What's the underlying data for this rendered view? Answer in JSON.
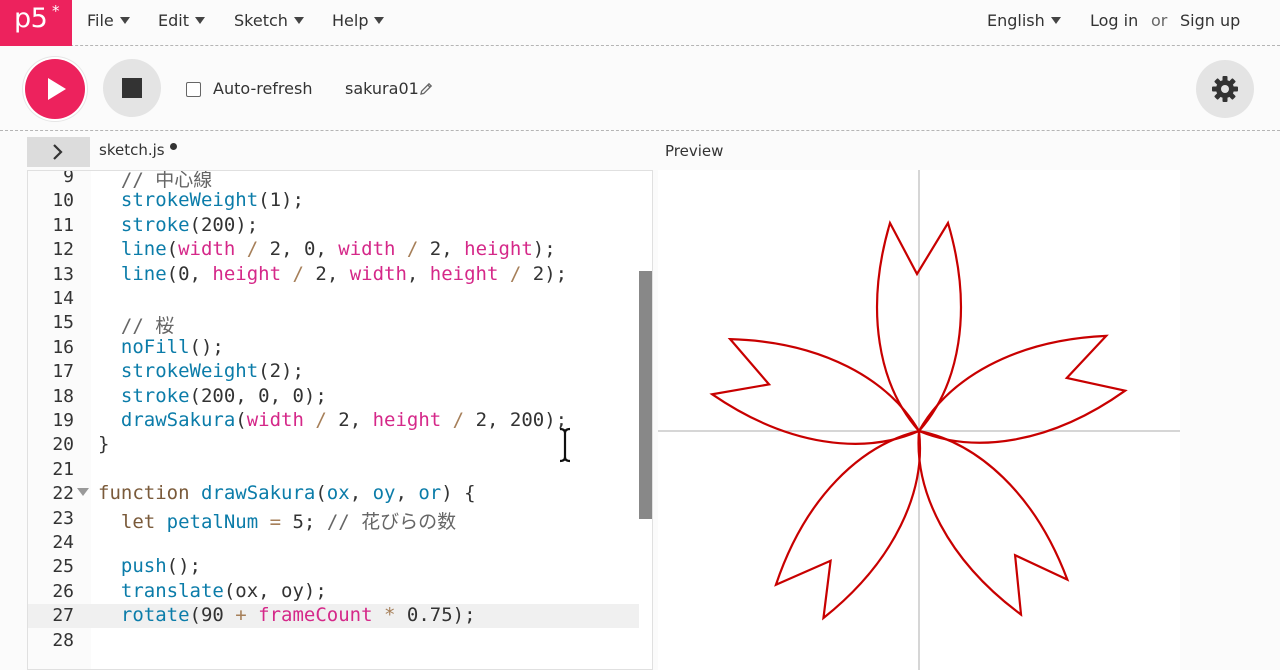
{
  "nav": {
    "logo": "p5",
    "logo_star": "*",
    "menus": [
      "File",
      "Edit",
      "Sketch",
      "Help"
    ],
    "language": "English",
    "login": "Log in",
    "or": "or",
    "signup": "Sign up"
  },
  "toolbar": {
    "auto_refresh_label": "Auto-refresh",
    "auto_refresh_checked": false,
    "sketch_name": "sakura01"
  },
  "editor": {
    "file_tab": "sketch.js",
    "unsaved": true,
    "lines": [
      {
        "num": "9",
        "tokens": [
          [
            "cm",
            "  // 中心線"
          ]
        ]
      },
      {
        "num": "10",
        "tokens": [
          [
            "fn",
            "  strokeWeight"
          ],
          [
            "",
            "(1);"
          ]
        ]
      },
      {
        "num": "11",
        "tokens": [
          [
            "fn",
            "  stroke"
          ],
          [
            "",
            "(200);"
          ]
        ]
      },
      {
        "num": "12",
        "tokens": [
          [
            "fn",
            "  line"
          ],
          [
            "",
            "("
          ],
          [
            "var",
            "width"
          ],
          [
            "op",
            " / "
          ],
          [
            "",
            "2, 0, "
          ],
          [
            "var",
            "width"
          ],
          [
            "op",
            " / "
          ],
          [
            "",
            "2, "
          ],
          [
            "var",
            "height"
          ],
          [
            "",
            ");"
          ]
        ]
      },
      {
        "num": "13",
        "tokens": [
          [
            "fn",
            "  line"
          ],
          [
            "",
            "(0, "
          ],
          [
            "var",
            "height"
          ],
          [
            "op",
            " / "
          ],
          [
            "",
            "2, "
          ],
          [
            "var",
            "width"
          ],
          [
            "",
            ", "
          ],
          [
            "var",
            "height"
          ],
          [
            "op",
            " / "
          ],
          [
            "",
            "2);"
          ]
        ]
      },
      {
        "num": "14",
        "tokens": []
      },
      {
        "num": "15",
        "tokens": [
          [
            "cm",
            "  // 桜"
          ]
        ]
      },
      {
        "num": "16",
        "tokens": [
          [
            "fn",
            "  noFill"
          ],
          [
            "",
            "();"
          ]
        ]
      },
      {
        "num": "17",
        "tokens": [
          [
            "fn",
            "  strokeWeight"
          ],
          [
            "",
            "(2);"
          ]
        ]
      },
      {
        "num": "18",
        "tokens": [
          [
            "fn",
            "  stroke"
          ],
          [
            "",
            "(200, 0, 0);"
          ]
        ]
      },
      {
        "num": "19",
        "tokens": [
          [
            "fn",
            "  drawSakura"
          ],
          [
            "",
            "("
          ],
          [
            "var",
            "width"
          ],
          [
            "op",
            " / "
          ],
          [
            "",
            "2, "
          ],
          [
            "var",
            "height"
          ],
          [
            "op",
            " / "
          ],
          [
            "",
            "2, 200);"
          ]
        ]
      },
      {
        "num": "20",
        "tokens": [
          [
            "",
            "}"
          ]
        ]
      },
      {
        "num": "21",
        "tokens": []
      },
      {
        "num": "22",
        "fold": true,
        "tokens": [
          [
            "kw",
            "function "
          ],
          [
            "fn",
            "drawSakura"
          ],
          [
            "",
            "("
          ],
          [
            "fn",
            "ox"
          ],
          [
            "",
            ", "
          ],
          [
            "fn",
            "oy"
          ],
          [
            "",
            ", "
          ],
          [
            "fn",
            "or"
          ],
          [
            "",
            ") {"
          ]
        ]
      },
      {
        "num": "23",
        "tokens": [
          [
            "kw",
            "  let "
          ],
          [
            "fn",
            "petalNum"
          ],
          [
            "op",
            " = "
          ],
          [
            "",
            "5; "
          ],
          [
            "cm",
            "// 花びらの数"
          ]
        ]
      },
      {
        "num": "24",
        "tokens": []
      },
      {
        "num": "25",
        "tokens": [
          [
            "fn",
            "  push"
          ],
          [
            "",
            "();"
          ]
        ]
      },
      {
        "num": "26",
        "tokens": [
          [
            "fn",
            "  translate"
          ],
          [
            "",
            "(ox, oy);"
          ]
        ]
      },
      {
        "num": "27",
        "active": true,
        "tokens": [
          [
            "fn",
            "  rotate"
          ],
          [
            "",
            "(90 "
          ],
          [
            "op",
            "+ "
          ],
          [
            "var",
            "frameCount"
          ],
          [
            "op",
            " * "
          ],
          [
            "",
            "0.75);"
          ]
        ]
      },
      {
        "num": "28",
        "tokens": []
      }
    ]
  },
  "preview": {
    "label": "Preview",
    "crosshair_color": "#c8c8c8",
    "sakura_color": "#c80000",
    "petal_count": 5
  },
  "icons": {
    "play": "play-icon",
    "stop": "stop-icon",
    "settings": "gear-icon",
    "edit_name": "pencil-icon",
    "collapse": "chevron-right-icon",
    "text_cursor": "text-cursor-icon"
  }
}
